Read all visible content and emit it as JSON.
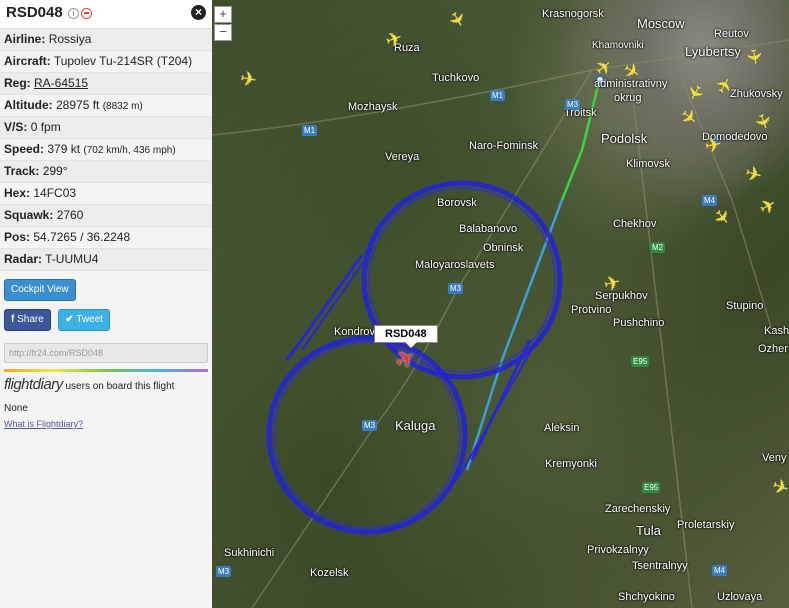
{
  "panel": {
    "flight_id": "RSD048",
    "info_icon": "i",
    "rows": [
      {
        "label": "Airline:",
        "value": "Rossiya"
      },
      {
        "label": "Aircraft:",
        "value": "Tupolev Tu-214SR (T204)"
      },
      {
        "label": "Reg:",
        "value": "RA-64515"
      },
      {
        "label": "Altitude:",
        "value": "28975 ft",
        "extra": "(8832 m)"
      },
      {
        "label": "V/S:",
        "value": "0 fpm"
      },
      {
        "label": "Speed:",
        "value": "379 kt",
        "extra": "(702 km/h, 436 mph)"
      },
      {
        "label": "Track:",
        "value": "299°"
      },
      {
        "label": "Hex:",
        "value": "14FC03"
      },
      {
        "label": "Squawk:",
        "value": "2760"
      },
      {
        "label": "Pos:",
        "value": "54.7265 / 36.2248"
      },
      {
        "label": "Radar:",
        "value": "T-UUMU4"
      }
    ],
    "cockpit_view": "Cockpit View",
    "share": "Share",
    "tweet": "Tweet",
    "url": "http://fr24.com/RSD048",
    "flightdiary_logo": "flightdiary",
    "flightdiary_text": "users on board this flight",
    "flightdiary_none": "None",
    "flightdiary_link": "What is Flightdiary?"
  },
  "map": {
    "zoom_in": "+",
    "zoom_out": "−",
    "callout": "RSD048",
    "cities": [
      {
        "name": "Krasnogorsk",
        "big": false
      },
      {
        "name": "Moscow",
        "big": true
      },
      {
        "name": "Reutov",
        "big": false
      },
      {
        "name": "Ruza",
        "big": false
      },
      {
        "name": "Khamovniki",
        "big": false
      },
      {
        "name": "Lyubertsy",
        "big": true
      },
      {
        "name": "Tuchkovo",
        "big": false
      },
      {
        "name": "administrativny",
        "big": false
      },
      {
        "name": "okrug",
        "big": false
      },
      {
        "name": "Zhukovsky",
        "big": false
      },
      {
        "name": "Mozhaysk",
        "big": false
      },
      {
        "name": "Troitsk",
        "big": false
      },
      {
        "name": "Podolsk",
        "big": true
      },
      {
        "name": "Domodedovo",
        "big": false
      },
      {
        "name": "Vereya",
        "big": false
      },
      {
        "name": "Naro-Fominsk",
        "big": false
      },
      {
        "name": "Klimovsk",
        "big": false
      },
      {
        "name": "Borovsk",
        "big": false
      },
      {
        "name": "Balabanovo",
        "big": false
      },
      {
        "name": "Chekhov",
        "big": false
      },
      {
        "name": "Obninsk",
        "big": false
      },
      {
        "name": "Maloyaroslavets",
        "big": false
      },
      {
        "name": "Serpukhov",
        "big": false
      },
      {
        "name": "Stupino",
        "big": false
      },
      {
        "name": "Protvino",
        "big": false
      },
      {
        "name": "Pushchino",
        "big": false
      },
      {
        "name": "Kondrovo",
        "big": false
      },
      {
        "name": "Kaluga",
        "big": true
      },
      {
        "name": "Aleksin",
        "big": false
      },
      {
        "name": "Kremyonki",
        "big": false
      },
      {
        "name": "Zarechenskiy",
        "big": false
      },
      {
        "name": "Tula",
        "big": true
      },
      {
        "name": "Proletarskiy",
        "big": false
      },
      {
        "name": "Privokzalnyy",
        "big": false
      },
      {
        "name": "Tsentralnyy",
        "big": false
      },
      {
        "name": "Sukhinichi",
        "big": false
      },
      {
        "name": "Kozelsk",
        "big": false
      },
      {
        "name": "Shchyokino",
        "big": false
      },
      {
        "name": "Uzlovaya",
        "big": false
      },
      {
        "name": "Kash",
        "big": false
      },
      {
        "name": "Ozher",
        "big": false
      },
      {
        "name": "Veny",
        "big": false
      }
    ],
    "highways": [
      "M1",
      "M1",
      "M3",
      "M3",
      "M3",
      "M3",
      "M4",
      "M2",
      "E95",
      "E95",
      "M4"
    ],
    "highway_green": [
      "M3"
    ]
  }
}
